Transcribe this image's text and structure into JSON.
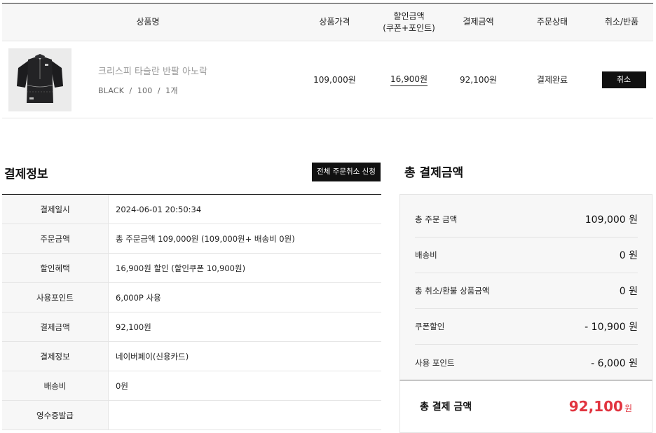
{
  "order_table": {
    "headers": {
      "name": "상품명",
      "price": "상품가격",
      "discount_line1": "할인금액",
      "discount_line2": "(쿠폰+포인트)",
      "payment": "결제금액",
      "status": "주문상태",
      "cancel": "취소/반품"
    },
    "item": {
      "title": "크리스피 타슬란 반팔 아노락",
      "option": "BLACK  /  100  /  1개",
      "price": "109,000원",
      "discount": "16,900원",
      "payment": "92,100원",
      "status": "결제완료",
      "cancel_label": "취소",
      "thumbnail_icon": "jacket-thumbnail-icon"
    }
  },
  "payment_info": {
    "title": "결제정보",
    "cancel_all_label": "전체 주문취소 신청",
    "rows": [
      {
        "label": "결제일시",
        "value": "2024-06-01 20:50:34"
      },
      {
        "label": "주문금액",
        "value": "총 주문금액 109,000원 (109,000원+ 배송비 0원)"
      },
      {
        "label": "할인혜택",
        "value": "16,900원 할인 (할인쿠폰 10,900원)"
      },
      {
        "label": "사용포인트",
        "value": "6,000P 사용"
      },
      {
        "label": "결제금액",
        "value": "92,100원"
      },
      {
        "label": "결제정보",
        "value": "네이버페이(신용카드)"
      },
      {
        "label": "배송비",
        "value": "0원"
      },
      {
        "label": "영수증발급",
        "value": ""
      }
    ]
  },
  "total_summary": {
    "title": "총 결제금액",
    "items": [
      {
        "label": "총 주문 금액",
        "value": "109,000 원"
      },
      {
        "label": "배송비",
        "value": "0 원"
      },
      {
        "label": "총 취소/환불 상품금액",
        "value": "0 원"
      },
      {
        "label": "쿠폰할인",
        "value": "- 10,900 원"
      },
      {
        "label": "사용 포인트",
        "value": "- 6,000 원"
      }
    ],
    "final_label": "총 결제 금액",
    "final_amount": "92,100",
    "final_unit": "원",
    "accent_color": "#e1343f"
  }
}
